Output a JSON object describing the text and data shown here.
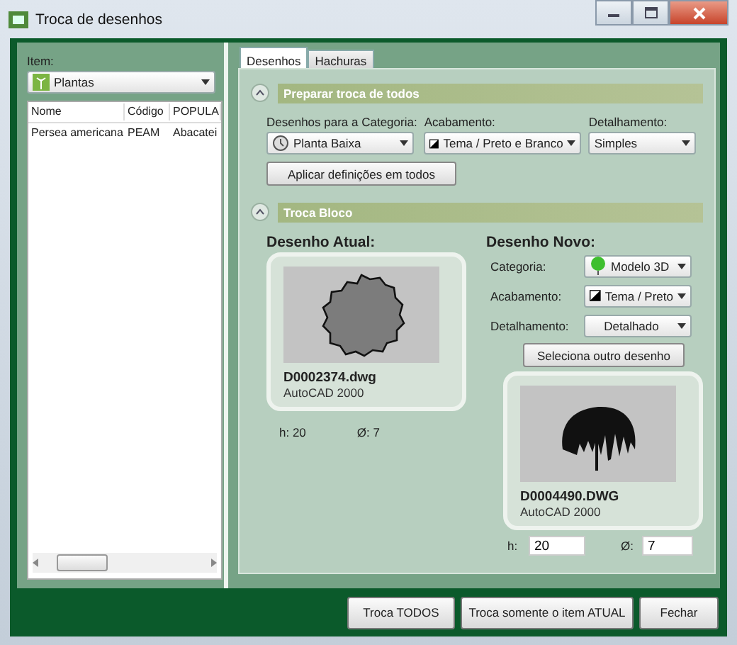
{
  "window": {
    "title": "Troca de desenhos"
  },
  "item": {
    "label": "Item:",
    "value": "Plantas"
  },
  "list": {
    "columns": [
      "Nome",
      "Código",
      "POPULA"
    ],
    "rows": [
      {
        "cells": [
          "Persea americana",
          "PEAM",
          "Abacatei"
        ],
        "selected": false
      }
    ]
  },
  "tabs": [
    {
      "label": "Desenhos",
      "selected": true
    },
    {
      "label": "Hachuras",
      "selected": false
    }
  ],
  "prepare": {
    "title": "Preparar troca de todos",
    "expanded": true,
    "fields": [
      {
        "label": "Desenhos para a Categoria:",
        "value": "Planta Baixa"
      },
      {
        "label": "Acabamento:",
        "value": "Tema / Preto e Branco"
      },
      {
        "label": "Detalhamento:",
        "value": "Simples"
      }
    ],
    "apply_button": "Aplicar definições em todos"
  },
  "block": {
    "title": "Troca Bloco",
    "expanded": true,
    "current": {
      "heading": "Desenho Atual:",
      "file": "D0002374.dwg",
      "format": "AutoCAD 2000",
      "h": "h: 20",
      "d": "Ø: 7"
    },
    "new": {
      "heading": "Desenho Novo:",
      "fields": [
        {
          "label": "Categoria:",
          "value": "Modelo 3D"
        },
        {
          "label": "Acabamento:",
          "value": "Tema / Preto"
        },
        {
          "label": "Detalhamento:",
          "value": "Detalhado"
        }
      ],
      "select_button": "Seleciona outro desenho",
      "file": "D0004490.DWG",
      "format": "AutoCAD 2000",
      "h_label": "h:",
      "h_value": "20",
      "d_label": "Ø:",
      "d_value": "7"
    }
  },
  "buttons": [
    "Troca TODOS",
    "Troca somente o item ATUAL",
    "Fechar"
  ]
}
